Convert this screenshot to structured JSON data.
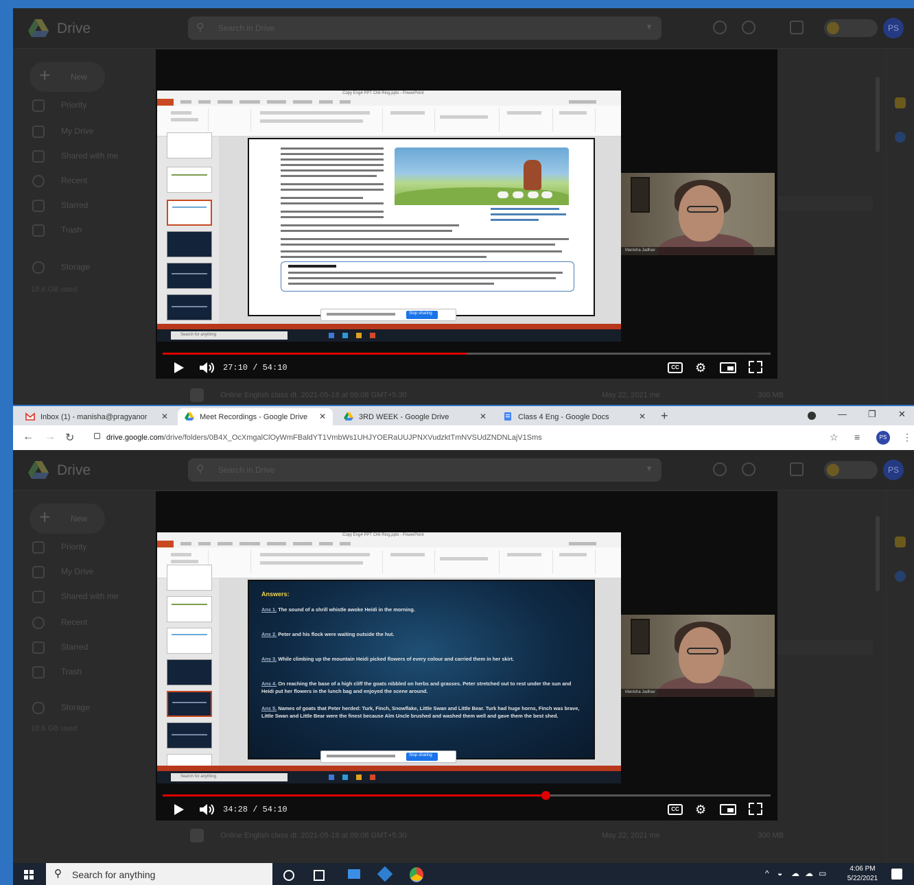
{
  "drive": {
    "app_name": "Drive",
    "search_placeholder": "Search in Drive",
    "new_label": "New",
    "sidebar": [
      {
        "label": "Priority"
      },
      {
        "label": "My Drive"
      },
      {
        "label": "Shared with me"
      },
      {
        "label": "Recent"
      },
      {
        "label": "Starred"
      },
      {
        "label": "Trash"
      },
      {
        "label": "Storage"
      }
    ],
    "storage_note": "18.6 GB used",
    "file_row": {
      "name": "Online English class dt. 2021-05-18 at 09:08 GMT+5:30",
      "owner": "me",
      "date": "May 22, 2021 me",
      "size": "300 MB"
    }
  },
  "players": [
    {
      "time": "27:10 / 54:10",
      "progress": 0.5,
      "slide_kind": "text_with_image",
      "ppt_title": "Copy Eng4 PPT Ch6 Ring.pptx - PowerPoint",
      "notification_button": "Stop sharing",
      "taskbar_search": "Search for anything",
      "presenter": "Manisha Jadhav"
    },
    {
      "time": "34:28 / 54:10",
      "progress": 0.63,
      "slide_kind": "answers",
      "ppt_title": "Copy Eng4 PPT Ch6 Ring.pptx - PowerPoint",
      "notification_button": "Stop sharing",
      "taskbar_search": "Search for anything",
      "presenter": "Manisha Jadhav",
      "answers_heading": "Answers:",
      "answers": [
        {
          "num": "Ans 1.",
          "text": "The sound of a shrill whistle awoke Heidi in the morning."
        },
        {
          "num": "Ans 2.",
          "text": "Peter and his flock were waiting outside the hut."
        },
        {
          "num": "Ans 3.",
          "text": "While climbing up the mountain Heidi picked flowers of every colour and carried them in her skirt."
        },
        {
          "num": "Ans 4.",
          "text": "On reaching the base of a high cliff the goats nibbled on herbs and grasses. Peter stretched out to rest under the sun and Heidi put her flowers in the lunch bag and enjoyed the scene around."
        },
        {
          "num": "Ans 5.",
          "text": "Names of goats that Peter herded: Turk, Finch, Snowflake, Little Swan and Little Bear. Turk had huge horns, Finch was brave, Little Swan and Little Bear were the finest because Alm Uncle brushed and washed them well and gave them the best shed."
        }
      ]
    }
  ],
  "browser": {
    "tabs": [
      {
        "label": "Inbox (1) - manisha@pragyanor",
        "active": false
      },
      {
        "label": "Meet Recordings - Google Drive",
        "active": true
      },
      {
        "label": "3RD WEEK - Google Drive",
        "active": false
      },
      {
        "label": "Class 4 Eng - Google Docs",
        "active": false
      }
    ],
    "url_host": "drive.google.com",
    "url_path": "/drive/folders/0B4X_OcXmgalClOyWmFBaldYT1VmbWs1UHJYOERaUUJPNXVudzktTmNVSUdZNDNLajV1Sms",
    "profile_initials": "PS"
  },
  "taskbar": {
    "search_placeholder": "Search for anything",
    "time": "4:06 PM",
    "date": "5/22/2021"
  },
  "colors": {
    "desktop": "#2d73c2",
    "progress": "#e00000",
    "powerpoint": "#c94a22"
  }
}
